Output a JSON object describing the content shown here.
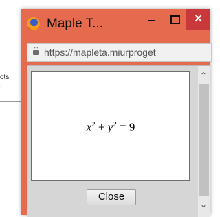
{
  "background": {
    "text_line_1": "ots",
    "text_line_2": "."
  },
  "window": {
    "title": "Maple T...",
    "minimize_glyph": "",
    "maximize_glyph": "",
    "close_glyph": "✕",
    "url": "https://mapleta.miurproget"
  },
  "content": {
    "equation": {
      "base_x": "x",
      "exp_x": "2",
      "plus": " + ",
      "base_y": "y",
      "exp_y": "2",
      "equals": " = 9"
    },
    "close_button_label": "Close"
  },
  "scrollbar": {
    "up_glyph": "⌃",
    "down_glyph": "⌄"
  },
  "colors": {
    "titlebar": "#e56a4e",
    "close_button": "#c9383a"
  }
}
